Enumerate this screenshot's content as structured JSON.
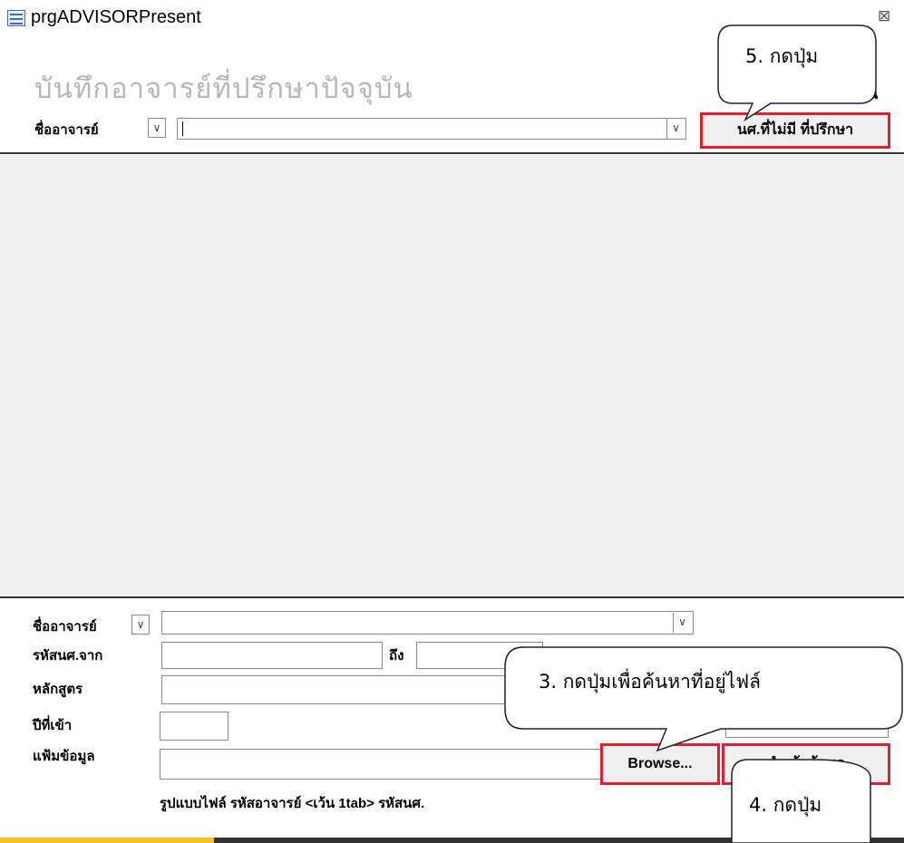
{
  "window": {
    "title": "prgADVISORPresent",
    "close_glyph": "⊠"
  },
  "header": {
    "title": "บันทึกอาจารย์ที่ปรึกษาปัจจุบัน",
    "partial_text": "้น",
    "advisor_label": "ชื่ออาจารย์",
    "no_advisor_button": "นศ.ที่ไม่มี ที่ปรึกษา"
  },
  "footer": {
    "advisor_label": "ชื่ออาจารย์",
    "student_from_label": "รหัสนศ.จาก",
    "to_label": "ถึง",
    "curriculum_label": "หลักสูตร",
    "entry_year_label": "ปีที่เข้า",
    "file_label": "แฟ้มข้อมูล",
    "browse_button": "Browse...",
    "import_button_partial": "นำเข้าข้อมูล",
    "format_hint": "รูปแบบไฟล์  รหัสอาจารย์ <เว้น 1tab> รหัสนศ."
  },
  "callouts": {
    "step3": "3.  กดปุ่มเพื่อค้นหาที่อยู่ไฟล์",
    "step4": "4.  กดปุ่ม",
    "step5": "5.  กดปุ่ม"
  },
  "icons": {
    "form": "form-icon",
    "dropdown": "chevron-down-icon",
    "close": "close-icon"
  },
  "colors": {
    "highlight": "#e0202a",
    "panel": "#f0f0f0",
    "status_bar": "#f3c12d"
  }
}
